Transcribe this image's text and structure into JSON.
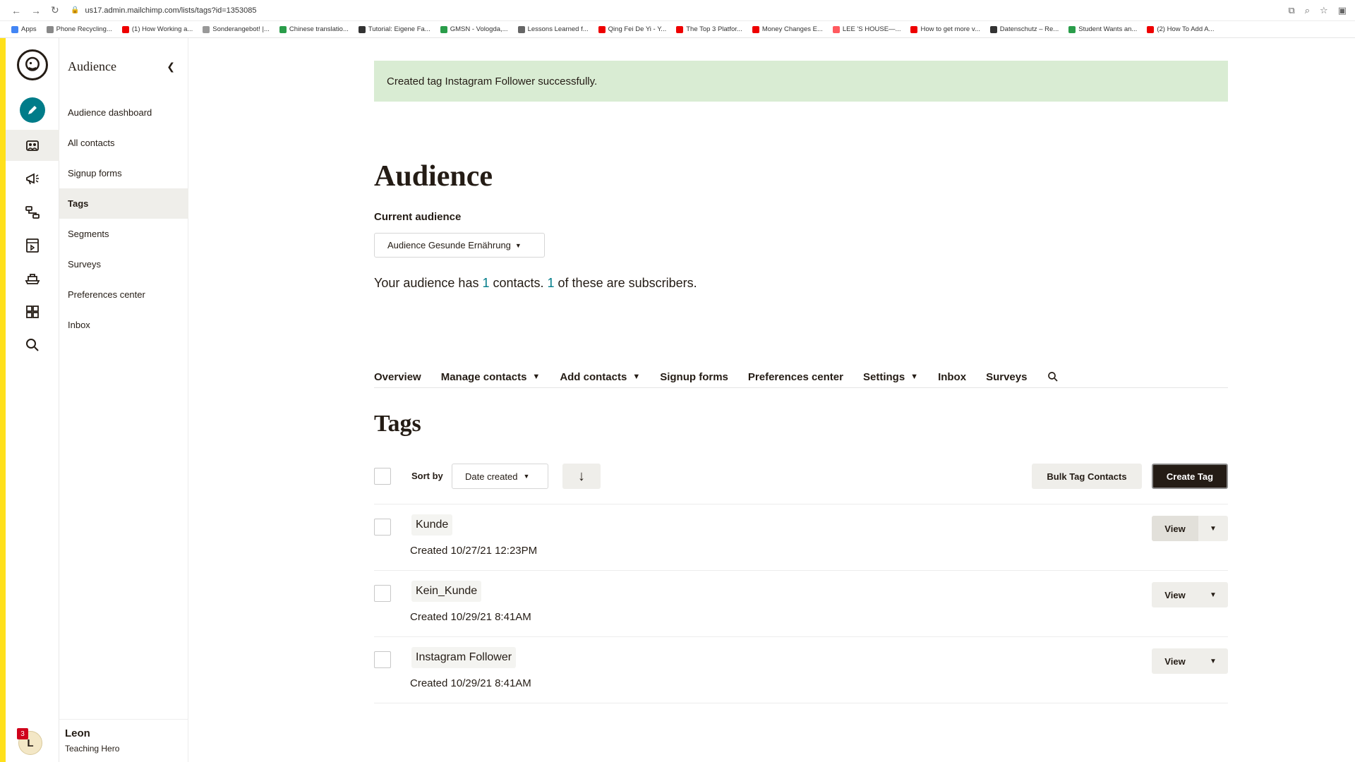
{
  "browser": {
    "url": "us17.admin.mailchimp.com/lists/tags?id=1353085",
    "bookmarks": [
      "Apps",
      "Phone Recycling...",
      "(1) How Working a...",
      "Sonderangebot! |...",
      "Chinese translatio...",
      "Tutorial: Eigene Fa...",
      "GMSN - Vologda,...",
      "Lessons Learned f...",
      "Qing Fei De Yi - Y...",
      "The Top 3 Platfor...",
      "Money Changes E...",
      "LEE 'S HOUSE—...",
      "How to get more v...",
      "Datenschutz – Re...",
      "Student Wants an...",
      "(2) How To Add A..."
    ]
  },
  "rail": {
    "notification_count": "3",
    "avatar_initial": "L"
  },
  "sidebar": {
    "title": "Audience",
    "items": [
      {
        "label": "Audience dashboard"
      },
      {
        "label": "All contacts"
      },
      {
        "label": "Signup forms"
      },
      {
        "label": "Tags"
      },
      {
        "label": "Segments"
      },
      {
        "label": "Surveys"
      },
      {
        "label": "Preferences center"
      },
      {
        "label": "Inbox"
      }
    ],
    "active": "Tags",
    "user": {
      "name": "Leon",
      "role": "Teaching Hero"
    }
  },
  "banner": {
    "text": "Created tag Instagram Follower successfully."
  },
  "page": {
    "title": "Audience",
    "current_audience_label": "Current audience",
    "audience_select": "Audience Gesunde Ernährung",
    "summary": {
      "prefix": "Your audience has ",
      "contacts": "1",
      "middle": " contacts. ",
      "subscribers": "1",
      "suffix": " of these are subscribers."
    }
  },
  "tabs": [
    {
      "label": "Overview"
    },
    {
      "label": "Manage contacts"
    },
    {
      "label": "Add contacts"
    },
    {
      "label": "Signup forms"
    },
    {
      "label": "Preferences center"
    },
    {
      "label": "Settings"
    },
    {
      "label": "Inbox"
    },
    {
      "label": "Surveys"
    }
  ],
  "tags_section": {
    "title": "Tags",
    "sort_by_label": "Sort by",
    "sort_value": "Date created",
    "sort_direction": "↓",
    "bulk_label": "Bulk Tag Contacts",
    "create_label": "Create Tag"
  },
  "tags": [
    {
      "name": "Kunde",
      "created": "Created 10/27/21 12:23PM",
      "action": "View"
    },
    {
      "name": "Kein_Kunde",
      "created": "Created 10/29/21 8:41AM",
      "action": "View"
    },
    {
      "name": "Instagram Follower",
      "created": "Created 10/29/21 8:41AM",
      "action": "View"
    }
  ],
  "colors": {
    "accent": "#ffe01b",
    "teal": "#007c89",
    "banner": "#d9ecd3",
    "dark": "#241c15"
  }
}
